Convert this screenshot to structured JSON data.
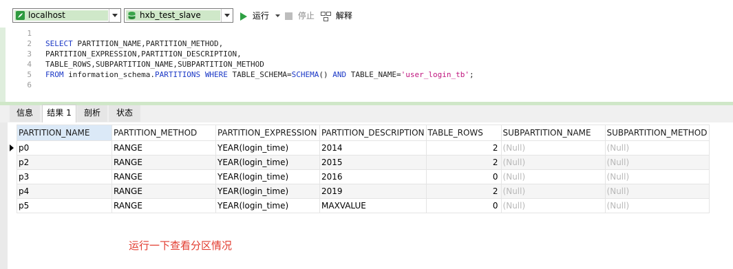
{
  "toolbar": {
    "connection": "localhost",
    "database": "hxb_test_slave",
    "run_label": "运行",
    "stop_label": "停止",
    "explain_label": "解释"
  },
  "editor": {
    "line_numbers": [
      "1",
      "2",
      "3",
      "4",
      "5",
      "6"
    ],
    "lines": [
      {
        "segments": []
      },
      {
        "segments": [
          {
            "t": "SELECT",
            "c": "kw"
          },
          {
            "t": " PARTITION_NAME,PARTITION_METHOD,",
            "c": ""
          }
        ]
      },
      {
        "segments": [
          {
            "t": "PARTITION_EXPRESSION,PARTITION_DESCRIPTION,",
            "c": ""
          }
        ]
      },
      {
        "segments": [
          {
            "t": "TABLE_ROWS,SUBPARTITION_NAME,SUBPARTITION_METHOD",
            "c": ""
          }
        ]
      },
      {
        "segments": [
          {
            "t": "FROM",
            "c": "kw"
          },
          {
            "t": " information_schema.",
            "c": ""
          },
          {
            "t": "PARTITIONS",
            "c": "kw"
          },
          {
            "t": " ",
            "c": ""
          },
          {
            "t": "WHERE",
            "c": "kw"
          },
          {
            "t": " TABLE_SCHEMA=",
            "c": ""
          },
          {
            "t": "SCHEMA",
            "c": "fn"
          },
          {
            "t": "() ",
            "c": ""
          },
          {
            "t": "AND",
            "c": "kw"
          },
          {
            "t": " TABLE_NAME=",
            "c": ""
          },
          {
            "t": "'user_login_tb'",
            "c": "str"
          },
          {
            "t": ";",
            "c": ""
          }
        ]
      },
      {
        "segments": []
      }
    ]
  },
  "tabs": [
    "信息",
    "结果 1",
    "剖析",
    "状态"
  ],
  "active_tab": 1,
  "grid": {
    "columns": [
      "PARTITION_NAME",
      "PARTITION_METHOD",
      "PARTITION_EXPRESSION",
      "PARTITION_DESCRIPTION",
      "TABLE_ROWS",
      "SUBPARTITION_NAME",
      "SUBPARTITION_METHOD"
    ],
    "rows": [
      [
        "p0",
        "RANGE",
        "YEAR(login_time)",
        "2014",
        "2",
        "(Null)",
        "(Null)"
      ],
      [
        "p2",
        "RANGE",
        "YEAR(login_time)",
        "2015",
        "2",
        "(Null)",
        "(Null)"
      ],
      [
        "p3",
        "RANGE",
        "YEAR(login_time)",
        "2016",
        "0",
        "(Null)",
        "(Null)"
      ],
      [
        "p4",
        "RANGE",
        "YEAR(login_time)",
        "2019",
        "2",
        "(Null)",
        "(Null)"
      ],
      [
        "p5",
        "RANGE",
        "YEAR(login_time)",
        "MAXVALUE",
        "0",
        "(Null)",
        "(Null)"
      ]
    ],
    "current_row": 0
  },
  "annotation": "运行一下查看分区情况",
  "colors": {
    "accent_green": "#cfe8c9",
    "keyword_blue": "#1a37c6",
    "string_magenta": "#c0147e",
    "annotation_red": "#e23b2e",
    "run_green": "#2ea043"
  }
}
